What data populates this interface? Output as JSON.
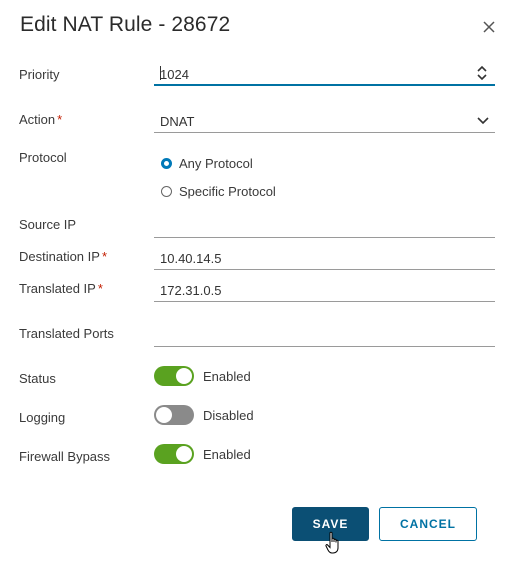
{
  "dialog": {
    "title": "Edit NAT Rule - 28672",
    "close_icon": "close-icon"
  },
  "form": {
    "priority": {
      "label": "Priority",
      "value": "1024"
    },
    "action": {
      "label": "Action",
      "required": "*",
      "value": "DNAT",
      "options_visible": [
        "DNAT"
      ]
    },
    "protocol": {
      "label": "Protocol",
      "options": [
        {
          "label": "Any Protocol",
          "checked": true
        },
        {
          "label": "Specific Protocol",
          "checked": false
        }
      ]
    },
    "source_ip": {
      "label": "Source IP",
      "value": ""
    },
    "destination_ip": {
      "label": "Destination IP",
      "required": "*",
      "value": "10.40.14.5"
    },
    "translated_ip": {
      "label": "Translated IP",
      "required": "*",
      "value": "172.31.0.5"
    },
    "translated_ports": {
      "label": "Translated Ports",
      "value": ""
    },
    "status": {
      "label": "Status",
      "state": "Enabled",
      "on": true
    },
    "logging": {
      "label": "Logging",
      "state": "Disabled",
      "on": false
    },
    "firewall_bypass": {
      "label": "Firewall Bypass",
      "state": "Enabled",
      "on": true
    }
  },
  "buttons": {
    "save": "SAVE",
    "cancel": "CANCEL"
  },
  "colors": {
    "primary": "#0b4f74",
    "accent": "#0072a3",
    "toggle_on": "#5aa220",
    "toggle_off": "#8a8a8a",
    "required": "#c21d00"
  }
}
